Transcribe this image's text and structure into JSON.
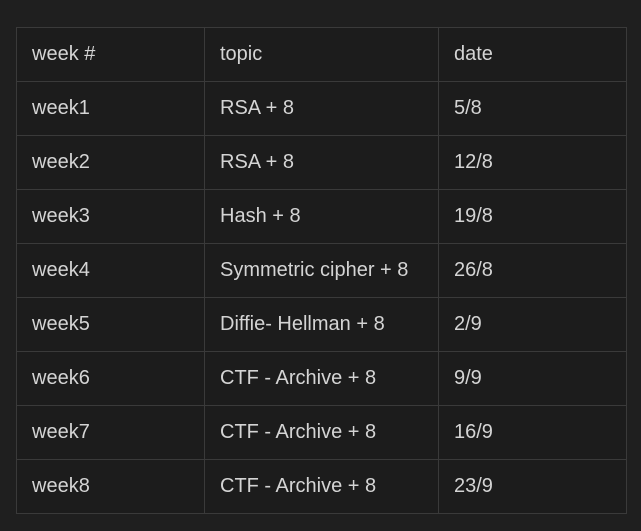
{
  "table": {
    "headers": [
      "week #",
      "topic",
      "date"
    ],
    "rows": [
      [
        "week1",
        "RSA + 8",
        "5/8"
      ],
      [
        "week2",
        "RSA + 8",
        "12/8"
      ],
      [
        "week3",
        "Hash + 8",
        "19/8"
      ],
      [
        "week4",
        "Symmetric cipher + 8",
        "26/8"
      ],
      [
        "week5",
        "Diffie- Hellman + 8",
        "2/9"
      ],
      [
        "week6",
        "CTF - Archive + 8",
        "9/9"
      ],
      [
        "week7",
        "CTF - Archive + 8",
        "16/9"
      ],
      [
        "week8",
        "CTF - Archive + 8",
        "23/9"
      ]
    ]
  }
}
